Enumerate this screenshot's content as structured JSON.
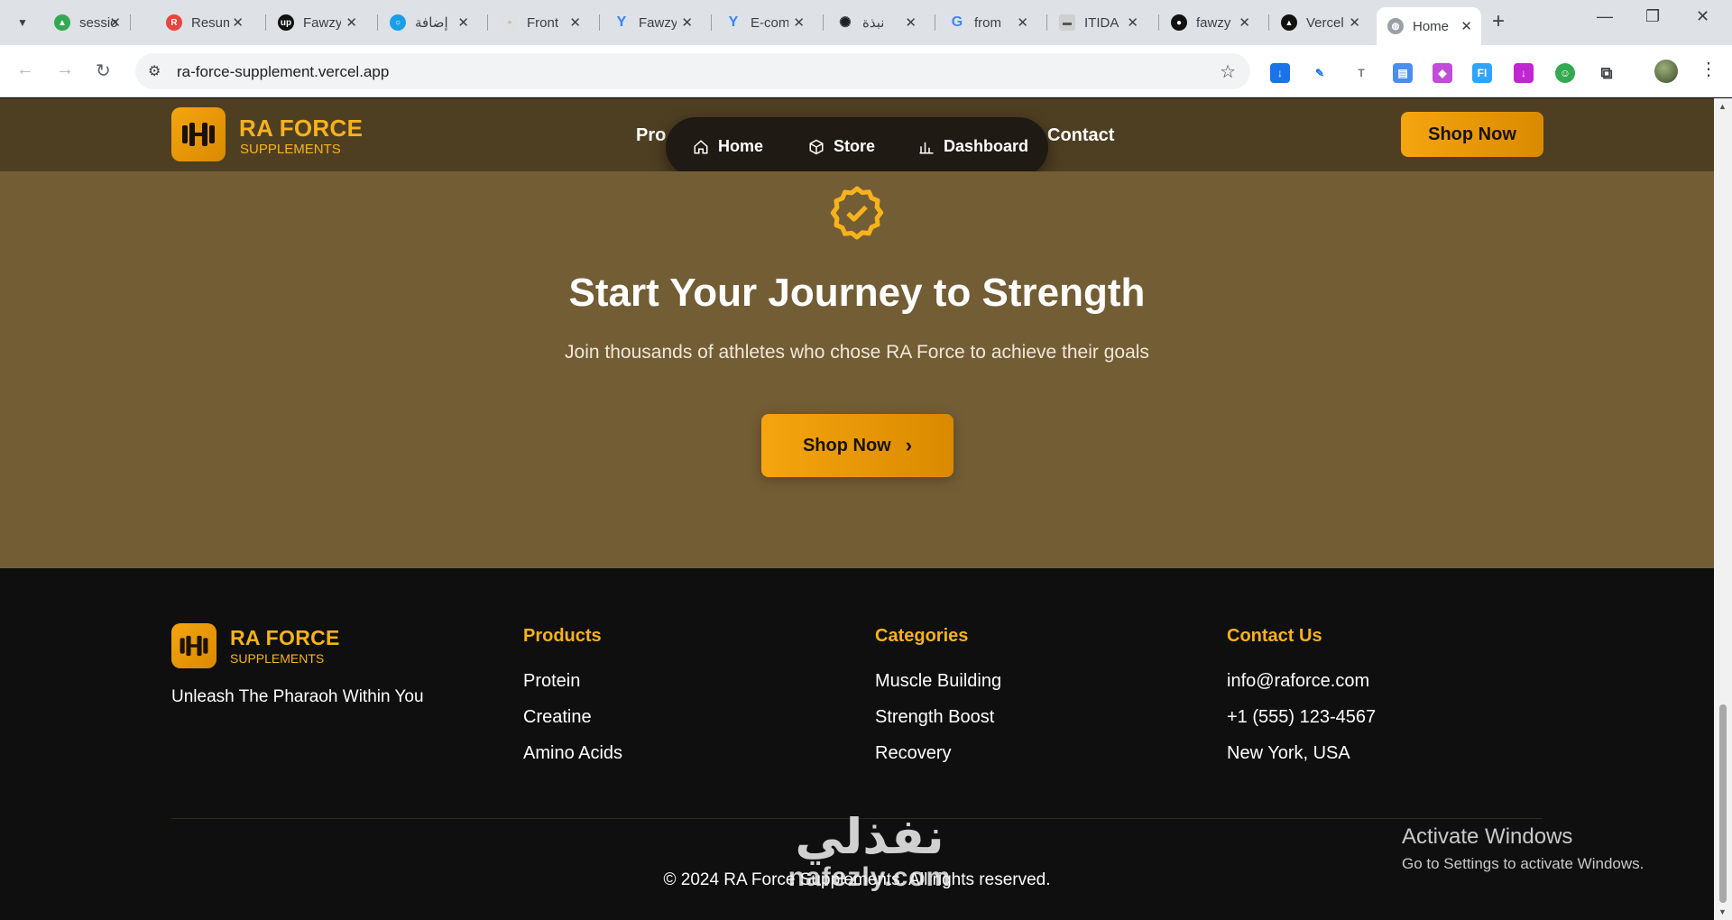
{
  "browser": {
    "tabs": [
      {
        "title": "sessions",
        "icon": "google-drive-icon",
        "color": "#34a853"
      },
      {
        "title": "Resume",
        "icon": "resume-app-icon",
        "color": "#e8453c"
      },
      {
        "title": "Fawzy",
        "icon": "upwork-icon",
        "color": "#111111"
      },
      {
        "title": "إضافة",
        "icon": "circle-app-icon",
        "color": "#1a9ee8"
      },
      {
        "title": "Front",
        "icon": "page-icon",
        "color": "#9aa0a6"
      },
      {
        "title": "Fawzy",
        "icon": "vercel-v-icon",
        "color": "#3b82f6"
      },
      {
        "title": "E-com",
        "icon": "vercel-v-icon",
        "color": "#3b82f6"
      },
      {
        "title": "نبذة",
        "icon": "chatgpt-icon",
        "color": "#202124"
      },
      {
        "title": "from",
        "icon": "google-icon",
        "color": "#4285f4"
      },
      {
        "title": "ITIDA",
        "icon": "itida-icon",
        "color": "#777777"
      },
      {
        "title": "fawzy",
        "icon": "github-icon",
        "color": "#111111"
      },
      {
        "title": "Vercel",
        "icon": "vercel-icon",
        "color": "#111111"
      },
      {
        "title": "Home",
        "icon": "globe-icon",
        "color": "#9aa0a6",
        "active": true
      }
    ],
    "url": "ra-force-supplement.vercel.app"
  },
  "site": {
    "brand": {
      "name": "RA FORCE",
      "sub": "SUPPLEMENTS"
    },
    "header_links": {
      "products": "Pro",
      "contact": "Contact"
    },
    "pill_nav": {
      "home": "Home",
      "store": "Store",
      "dashboard": "Dashboard"
    },
    "shop_now": "Shop Now",
    "accent": "#f7b21c"
  },
  "hero": {
    "title": "Start Your Journey to Strength",
    "subtitle": "Join thousands of athletes who chose RA Force to achieve their goals",
    "cta": "Shop Now"
  },
  "footer": {
    "tagline": "Unleash The Pharaoh Within You",
    "columns": [
      {
        "heading": "Products",
        "items": [
          "Protein",
          "Creatine",
          "Amino Acids"
        ]
      },
      {
        "heading": "Categories",
        "items": [
          "Muscle Building",
          "Strength Boost",
          "Recovery"
        ]
      },
      {
        "heading": "Contact Us",
        "items": [
          "info@raforce.com",
          "+1 (555) 123-4567",
          "New York, USA"
        ]
      }
    ],
    "copyright": "© 2024 RA Force Supplements. All rights reserved."
  },
  "overlay": {
    "activate_title": "Activate Windows",
    "activate_sub": "Go to Settings to activate Windows.",
    "watermark_logo": "نفذلي",
    "watermark_url": "nafezly.com"
  }
}
